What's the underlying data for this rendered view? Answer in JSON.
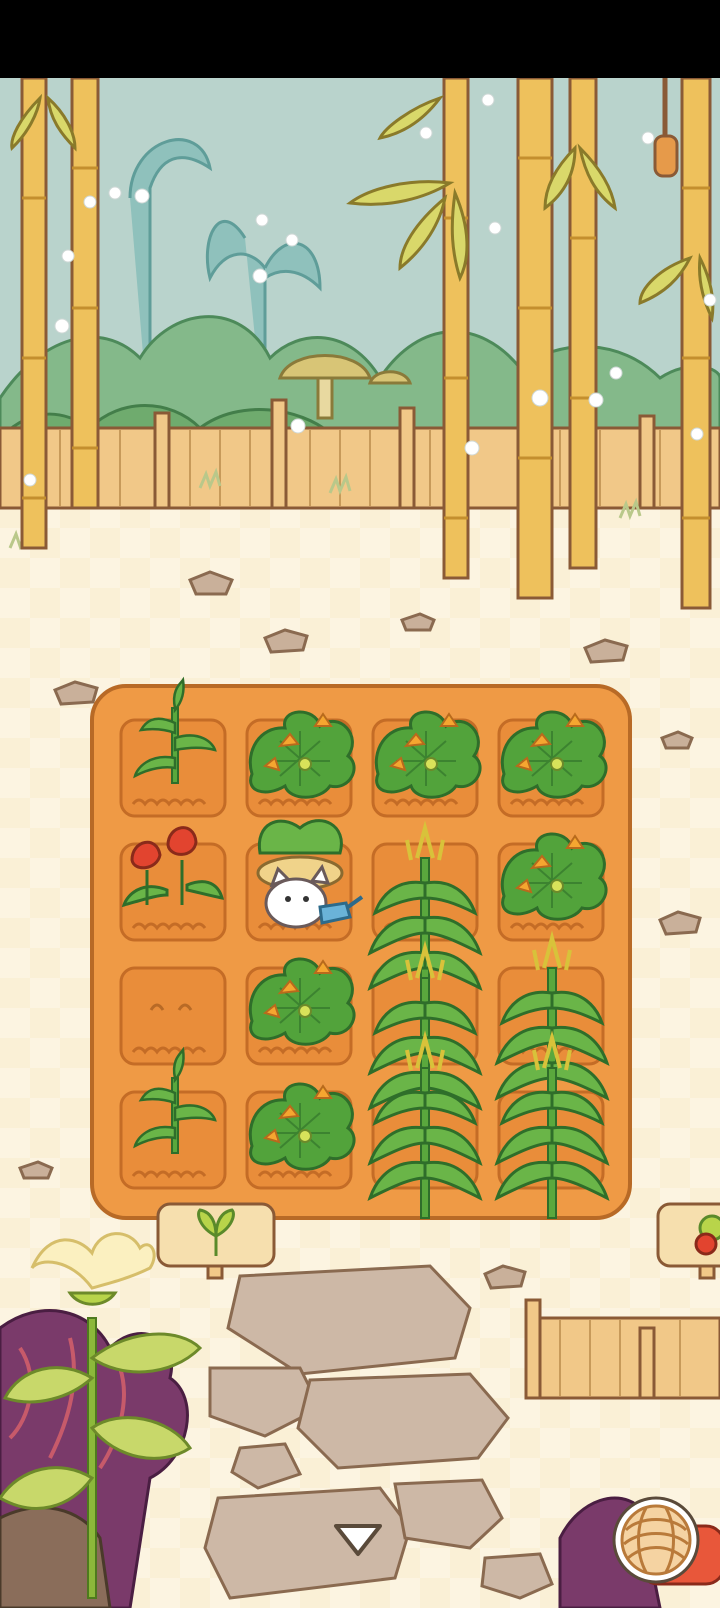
{
  "game": {
    "scene": "bamboo-garden",
    "plot": {
      "rows": 4,
      "cols": 4,
      "tiles": [
        [
          "sprout",
          "squash",
          "squash",
          "squash"
        ],
        [
          "flower-bud",
          "cat-gardener",
          "corn",
          "squash"
        ],
        [
          "empty-soil",
          "squash",
          "corn",
          "corn"
        ],
        [
          "sprout",
          "squash",
          "corn",
          "corn"
        ]
      ]
    },
    "signs": [
      "seedling-sign",
      "vegetable-sign"
    ],
    "icons": [
      "down-arrow-icon",
      "yarn-ball-icon",
      "rope-icon"
    ],
    "colors": {
      "sky": "#b9d3cc",
      "bamboo": "#eec15c",
      "soil": "#ef9a45",
      "leaf": "#4f9e3a",
      "fence": "#f1c888",
      "ground": "#fbf1dd",
      "outline": "#8a5a36"
    }
  }
}
